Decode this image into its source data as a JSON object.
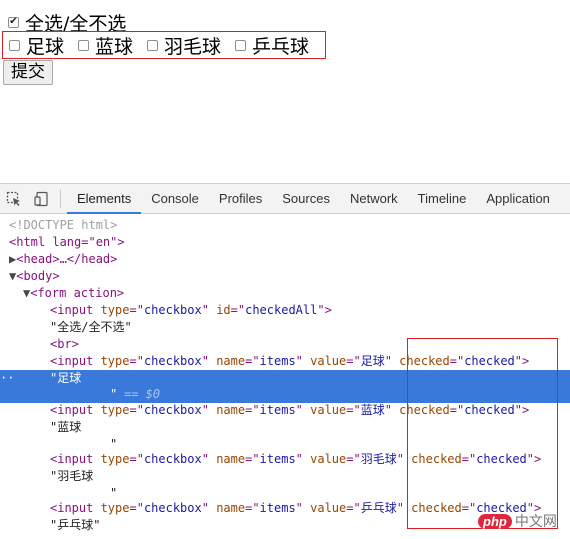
{
  "form": {
    "check_all_label": "全选/全不选",
    "items": [
      {
        "label": "足球"
      },
      {
        "label": "蓝球"
      },
      {
        "label": "羽毛球"
      },
      {
        "label": "乒乓球"
      }
    ],
    "submit_label": "提交"
  },
  "devtools": {
    "tabs": [
      "Elements",
      "Console",
      "Profiles",
      "Sources",
      "Network",
      "Timeline",
      "Application"
    ],
    "active_tab": "Elements",
    "dom": {
      "doctype": "<!DOCTYPE html>",
      "html_open": "<html lang=\"en\">",
      "head_collapsed": "<head>…</head>",
      "body_open": "<body>",
      "form_open": "<form action>",
      "input_all": {
        "type": "checkbox",
        "id": "checkedAll"
      },
      "text_all": "\"全选/全不选\"",
      "br": "<br>",
      "input_items": [
        {
          "name": "items",
          "value": "足球",
          "checked": "checked",
          "text": "\"足球",
          "text_end": "\"",
          "selected": true,
          "eq": "== $0"
        },
        {
          "name": "items",
          "value": "蓝球",
          "checked": "checked",
          "text": "\"蓝球",
          "text_end": "\""
        },
        {
          "name": "items",
          "value": "羽毛球",
          "checked": "checked",
          "text": "\"羽毛球",
          "text_end": "\""
        },
        {
          "name": "items",
          "value": "乒乓球",
          "checked": "checked",
          "text": "\"乒乓球\""
        }
      ]
    }
  },
  "watermark": {
    "brand": "php",
    "suffix": "中文网"
  }
}
